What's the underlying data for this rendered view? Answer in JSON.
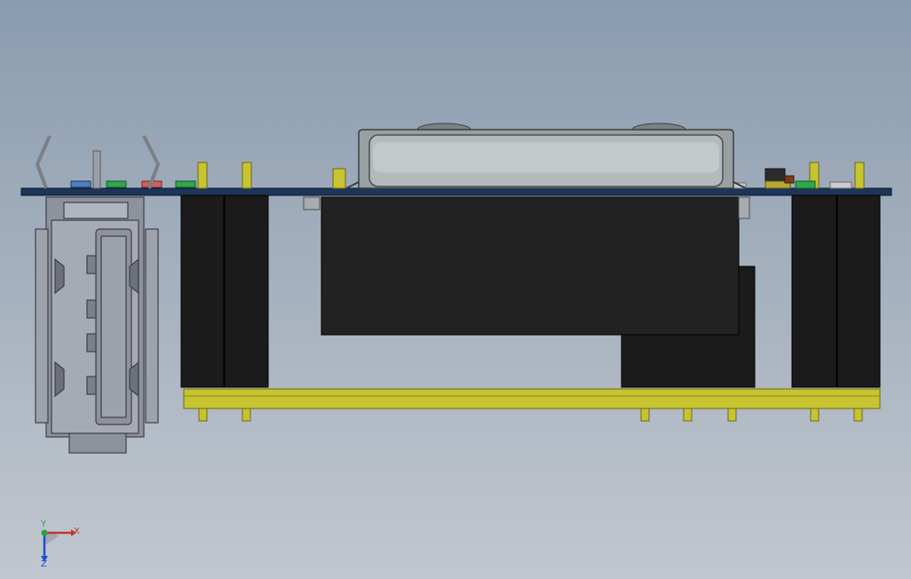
{
  "viewport": {
    "background_top": "#8a9cb0",
    "background_bottom": "#c2c7cf"
  },
  "model": {
    "pcb_color": "#1d3557",
    "pin_color": "#c8c431",
    "body_color": "#1b1b1b",
    "usb_color": "#8e929c",
    "battery_color": "#9aa0a2"
  },
  "triad": {
    "x_label": "X",
    "y_label": "Y",
    "z_label": "Z",
    "x_color": "#c0392b",
    "y_color": "#2ea043",
    "z_color": "#1f4fd1"
  }
}
